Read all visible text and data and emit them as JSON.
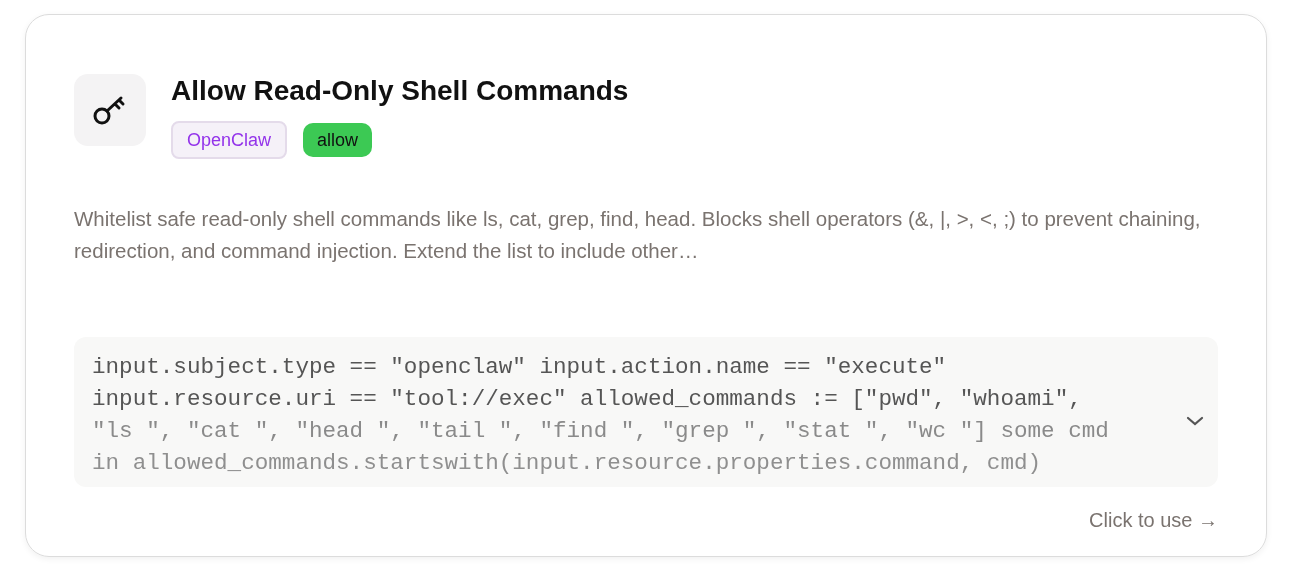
{
  "card": {
    "title": "Allow Read-Only Shell Commands",
    "tags": [
      {
        "label": "OpenClaw",
        "kind": "source"
      },
      {
        "label": "allow",
        "kind": "effect"
      }
    ],
    "description": "Whitelist safe read-only shell commands like ls, cat, grep, find, head. Blocks shell operators (&, |, >, <, ;) to prevent chaining, redirection, and command injection. Extend the list to include other…",
    "code": {
      "expanded": false,
      "lines": [
        "input.subject.type == \"openclaw\" input.action.name == \"execute\"",
        "input.resource.uri == \"tool://exec\" allowed_commands := [\"pwd\", \"whoami\",",
        "\"ls \", \"cat \", \"head \", \"tail \", \"find \", \"grep \", \"stat \", \"wc \"] some cmd",
        "in allowed_commands.startswith(input.resource.properties.command, cmd)"
      ]
    },
    "action": "Click to use →"
  }
}
